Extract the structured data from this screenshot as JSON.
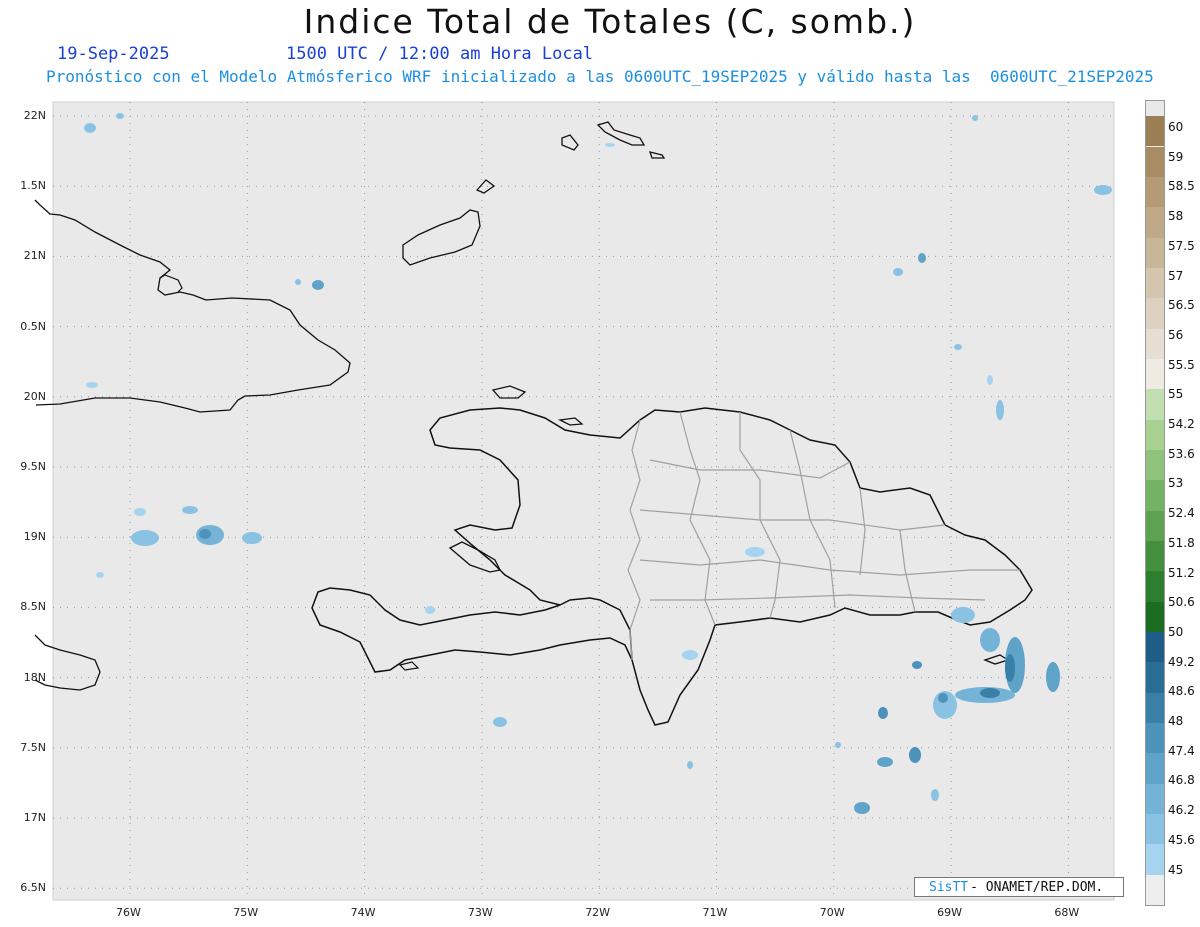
{
  "title": "Indice Total de Totales (C, somb.)",
  "date": "19-Sep-2025",
  "time": "1500 UTC / 12:00 am Hora Local",
  "forecast": "Pronóstico con el Modelo Atmósferico WRF inicializado a las 0600UTC_19SEP2025 y válido hasta las  0600UTC_21SEP2025",
  "credit": {
    "brand": "SisTT",
    "text": "- ONAMET/REP.DOM."
  },
  "lat_labels": [
    "22N",
    "1.5N",
    "21N",
    "0.5N",
    "20N",
    "9.5N",
    "19N",
    "8.5N",
    "18N",
    "7.5N",
    "17N",
    "6.5N"
  ],
  "lon_labels": [
    "76W",
    "75W",
    "74W",
    "73W",
    "72W",
    "71W",
    "70W",
    "69W",
    "68W"
  ],
  "colorbar": {
    "labels": [
      "60",
      "59",
      "58.5",
      "58",
      "57.5",
      "57",
      "56.5",
      "56",
      "55.5",
      "55",
      "54.2",
      "53.6",
      "53",
      "52.4",
      "51.8",
      "51.2",
      "50.6",
      "50",
      "49.2",
      "48.6",
      "48",
      "47.4",
      "46.8",
      "46.2",
      "45.6",
      "45"
    ],
    "colors": [
      "#e9e9e9",
      "#9a7f55",
      "#a88d64",
      "#b49b76",
      "#bfa987",
      "#c8b699",
      "#d4c6ae",
      "#ddd2c1",
      "#e6ded2",
      "#efeae2",
      "#c2dfb1",
      "#a8d091",
      "#8fc27a",
      "#74b264",
      "#5ca250",
      "#448f3e",
      "#2d7f30",
      "#1b6d22",
      "#1d5d87",
      "#2a6e98",
      "#3980a9",
      "#4c92ba",
      "#5fa3c9",
      "#74b3d6",
      "#8ac2e3",
      "#a6d4f0"
    ]
  },
  "colors": {
    "ocean": "#e9e9e9",
    "land_border": "#111111",
    "province_border": "#a0a0a0",
    "shade": "#7ab8e2"
  }
}
